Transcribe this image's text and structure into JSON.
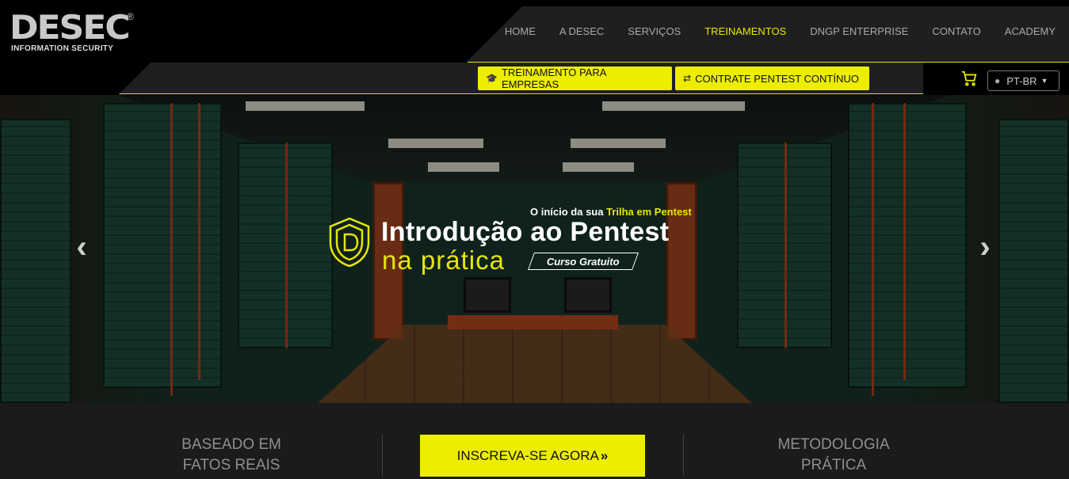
{
  "brand": {
    "name": "DESEC",
    "registered": "®",
    "subtitle": "INFORMATION SECURITY"
  },
  "nav": {
    "items": [
      {
        "label": "HOME"
      },
      {
        "label": "A DESEC"
      },
      {
        "label": "SERVIÇOS"
      },
      {
        "label": "TREINAMENTOS"
      },
      {
        "label": "DNGP ENTERPRISE"
      },
      {
        "label": "CONTATO"
      },
      {
        "label": "ACADEMY"
      }
    ],
    "active_color": "#e6e600"
  },
  "subbar": {
    "btn_empresas": "TREINAMENTO PARA EMPRESAS",
    "btn_pentest": "CONTRATE PENTEST CONTÍNUO",
    "language": "PT-BR"
  },
  "hero": {
    "tagline_prefix": "O início da sua ",
    "tagline_highlight": "Trilha em Pentest",
    "title_line1": "Introdução ao Pentest",
    "title_line2": "na prática",
    "badge": "Curso Gratuito",
    "prev_icon": "chevron-left-icon",
    "next_icon": "chevron-right-icon"
  },
  "features": {
    "left_line1": "BASEADO EM",
    "left_line2": "FATOS REAIS",
    "cta": "INSCREVA-SE AGORA",
    "cta_icon": "»",
    "right_line1": "METODOLOGIA",
    "right_line2": "PRÁTICA"
  },
  "colors": {
    "accent": "#eded00",
    "background": "#1b1b1b",
    "header": "#000000"
  }
}
